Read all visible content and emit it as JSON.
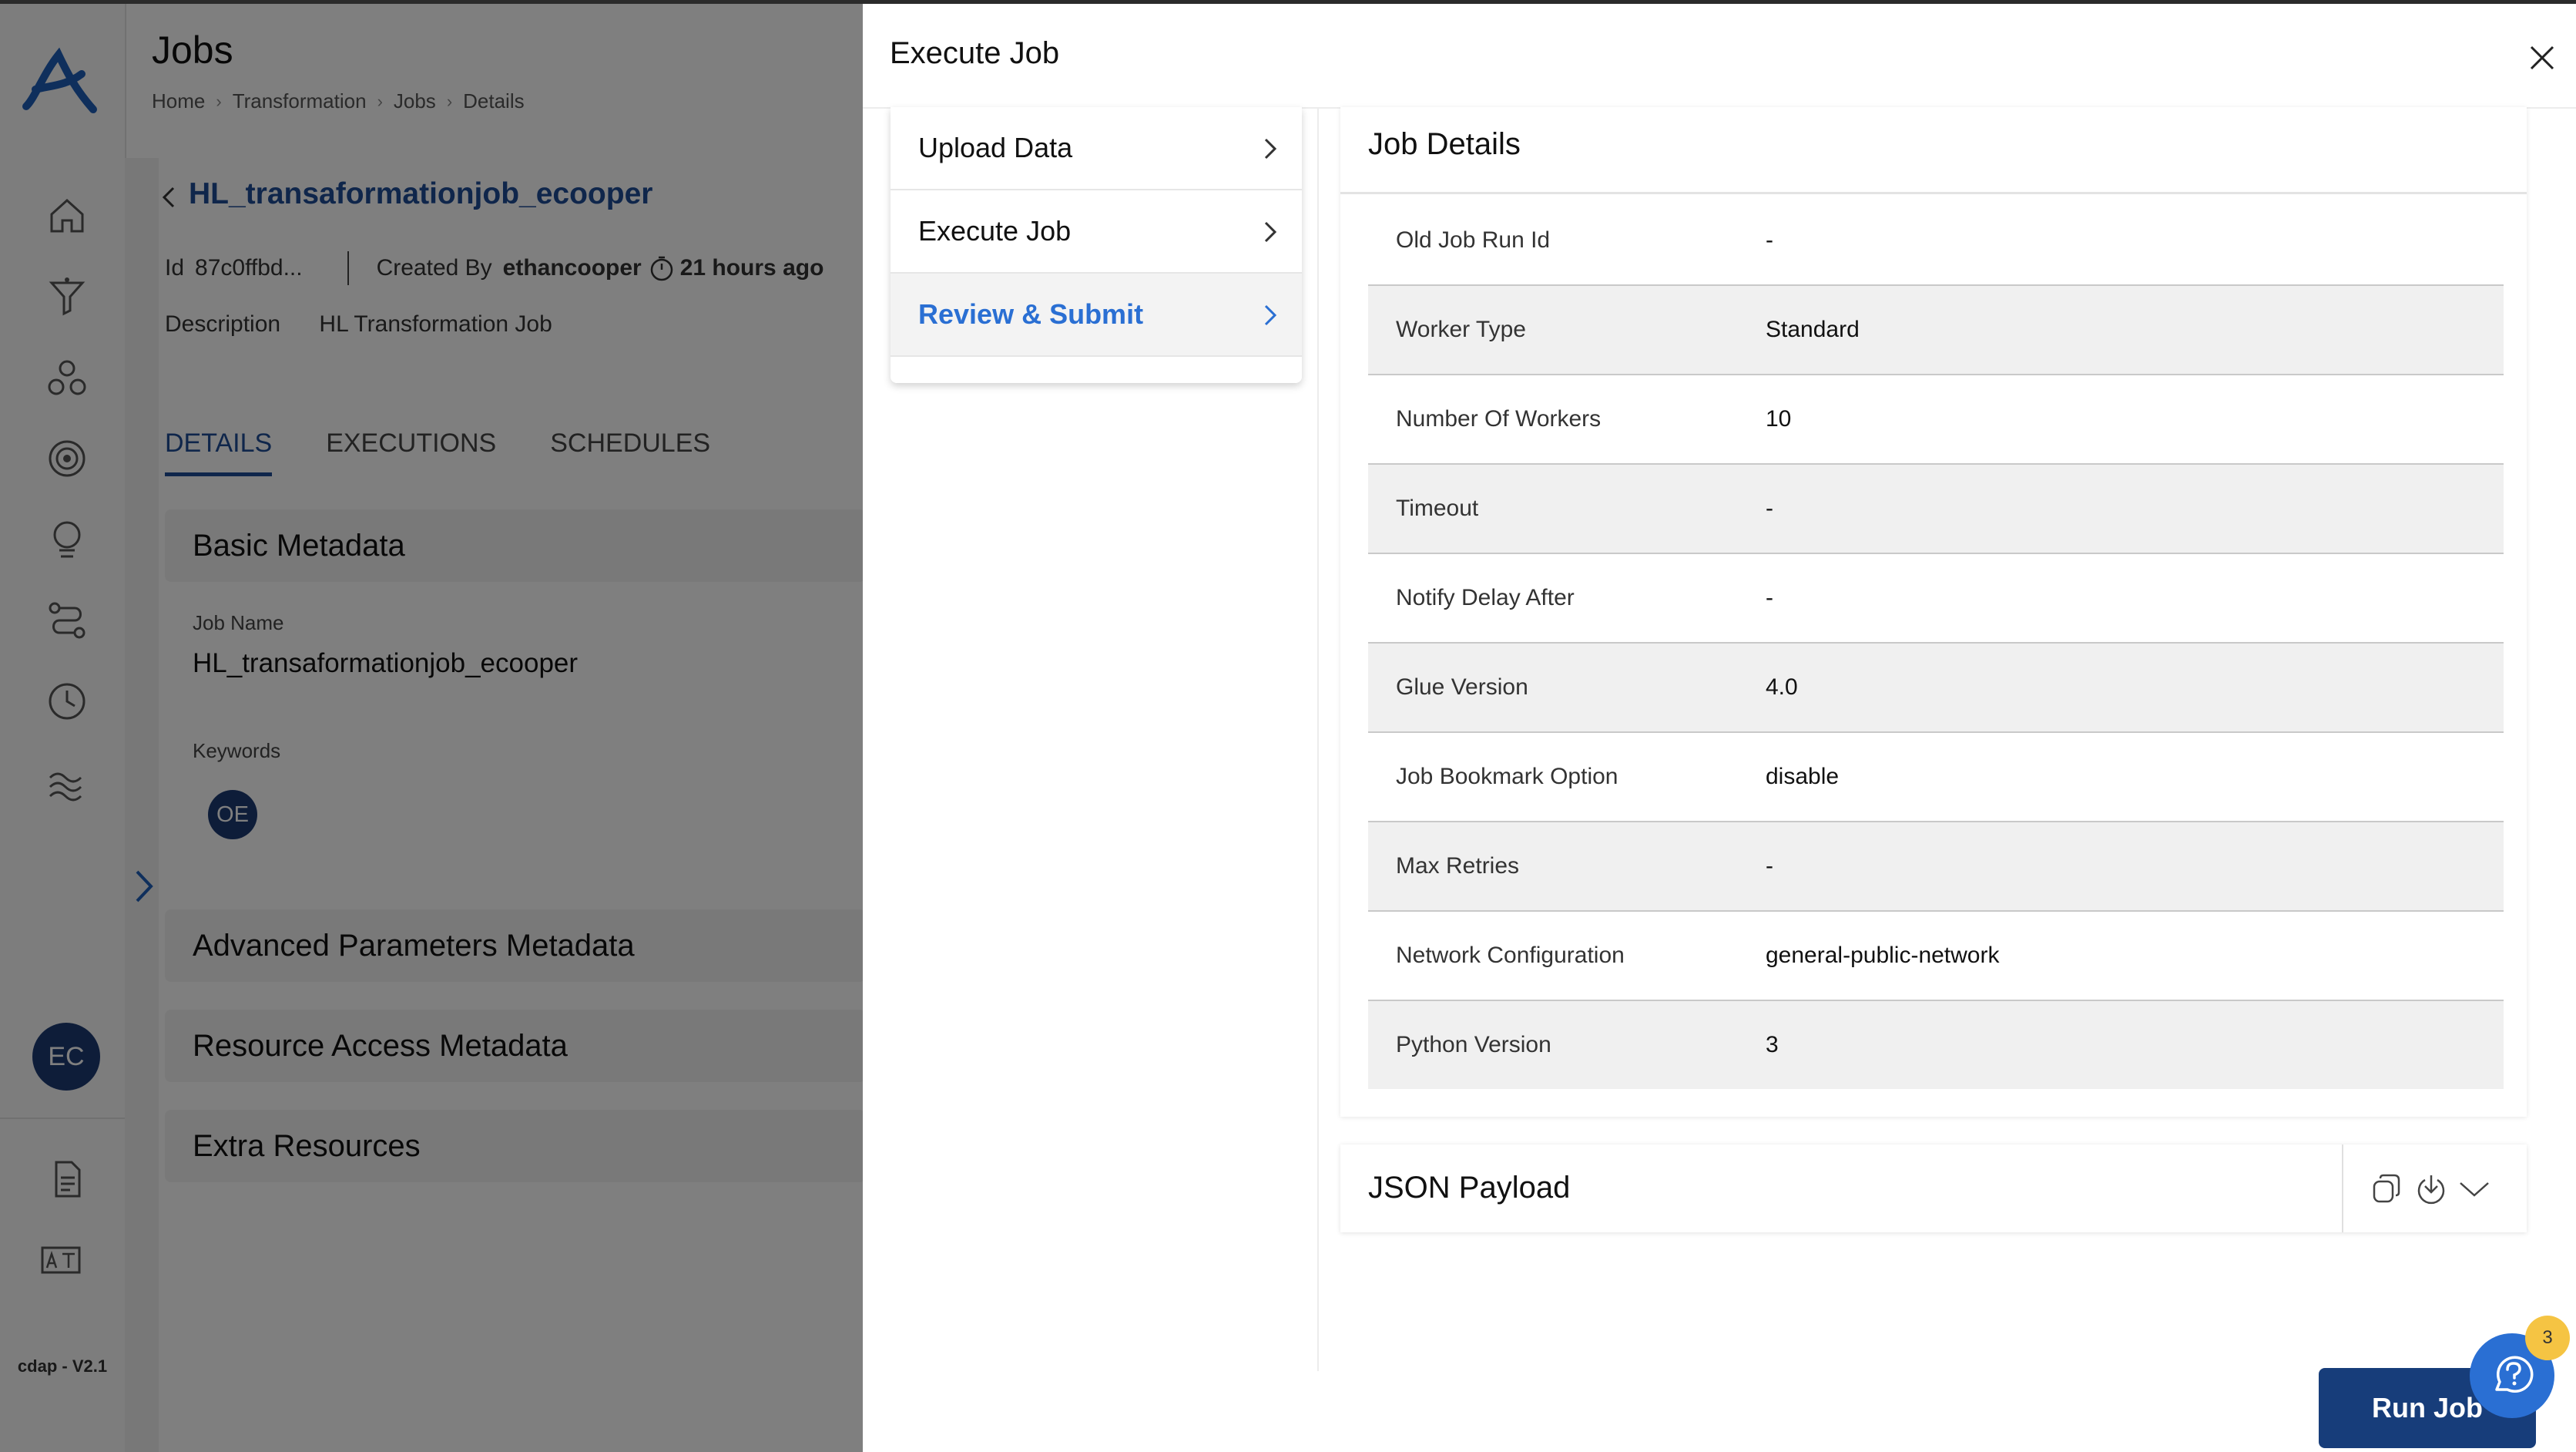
{
  "app": {
    "version": "cdap - V2.1",
    "user_initials": "EC"
  },
  "page": {
    "title": "Jobs",
    "breadcrumb": [
      "Home",
      "Transformation",
      "Jobs",
      "Details"
    ]
  },
  "job": {
    "name": "HL_transaformationjob_ecooper",
    "id_label": "Id",
    "id_value": "87c0ffbd...",
    "created_by_label": "Created By",
    "created_by": "ethancooper",
    "created_ago": "21 hours ago",
    "description_label": "Description",
    "description": "HL Transformation Job"
  },
  "tabs": [
    "DETAILS",
    "EXECUTIONS",
    "SCHEDULES"
  ],
  "basic_metadata": {
    "title": "Basic Metadata",
    "job_name_label": "Job Name",
    "job_name": "HL_transaformationjob_ecooper",
    "keywords_label": "Keywords",
    "keyword_chip": "OE"
  },
  "sections": {
    "advanced": "Advanced Parameters Metadata",
    "resource": "Resource Access Metadata",
    "extra": "Extra Resources"
  },
  "modal": {
    "title": "Execute Job",
    "steps": [
      {
        "label": "Upload Data"
      },
      {
        "label": "Execute Job"
      },
      {
        "label": "Review & Submit"
      }
    ],
    "details_title": "Job Details",
    "details": [
      {
        "key": "Old Job Run Id",
        "value": "-"
      },
      {
        "key": "Worker Type",
        "value": "Standard"
      },
      {
        "key": "Number Of Workers",
        "value": "10"
      },
      {
        "key": "Timeout",
        "value": "-"
      },
      {
        "key": "Notify Delay After",
        "value": "-"
      },
      {
        "key": "Glue Version",
        "value": "4.0"
      },
      {
        "key": "Job Bookmark Option",
        "value": "disable"
      },
      {
        "key": "Max Retries",
        "value": "-"
      },
      {
        "key": "Network Configuration",
        "value": "general-public-network"
      },
      {
        "key": "Python Version",
        "value": "3"
      }
    ],
    "json_payload_title": "JSON Payload",
    "run_button": "Run Job"
  },
  "help": {
    "badge_count": "3"
  },
  "colors": {
    "primary_dark": "#173d7a",
    "link_blue": "#2a6fd3",
    "badge_yellow": "#f5c443"
  }
}
